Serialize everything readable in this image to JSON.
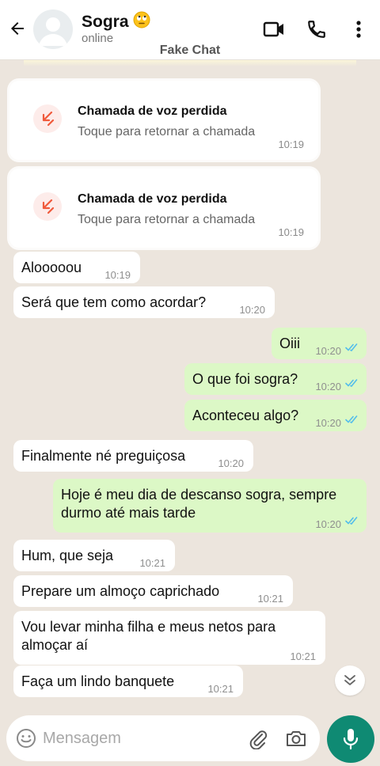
{
  "header": {
    "contact_name": "Sogra",
    "status": "online",
    "app_caption": "Fake Chat",
    "icons": [
      "back-arrow-icon",
      "avatar-placeholder",
      "rolling-eyes-emoji",
      "video-call-icon",
      "phone-icon",
      "more-vert-icon"
    ]
  },
  "missed_calls": [
    {
      "title": "Chamada de voz perdida",
      "subtitle": "Toque para retornar a chamada",
      "time": "10:19"
    },
    {
      "title": "Chamada de voz perdida",
      "subtitle": "Toque para retornar a chamada",
      "time": "10:19"
    }
  ],
  "messages": [
    {
      "dir": "in",
      "text": "Alooooou",
      "time": "10:19"
    },
    {
      "dir": "in",
      "text": "Será que tem como acordar?",
      "time": "10:20"
    },
    {
      "dir": "out",
      "text": "Oiii",
      "time": "10:20",
      "read": true
    },
    {
      "dir": "out",
      "text": "O que foi sogra?",
      "time": "10:20",
      "read": true
    },
    {
      "dir": "out",
      "text": "Aconteceu algo?",
      "time": "10:20",
      "read": true
    },
    {
      "dir": "in",
      "text": "Finalmente né preguiçosa",
      "time": "10:20"
    },
    {
      "dir": "out",
      "text_line1": "Hoje é meu dia de descanso sogra, sempre",
      "text_line2": "durmo até mais tarde",
      "time": "10:20",
      "read": true
    },
    {
      "dir": "in",
      "text": "Hum, que seja",
      "time": "10:21"
    },
    {
      "dir": "in",
      "text": "Prepare um almoço caprichado",
      "time": "10:21"
    },
    {
      "dir": "in",
      "text_line1": "Vou levar minha filha e meus netos para",
      "text_line2": "almoçar aí",
      "time": "10:21"
    },
    {
      "dir": "in",
      "text": "Faça um lindo banquete",
      "time": "10:21"
    }
  ],
  "input": {
    "placeholder": "Mensagem"
  },
  "colors": {
    "chat_bg": "#ece5dd",
    "outgoing_bubble": "#dcf8c6",
    "read_ticks": "#53bdeb",
    "accent": "#0f8a73",
    "missed_call": "#f05a3c"
  }
}
